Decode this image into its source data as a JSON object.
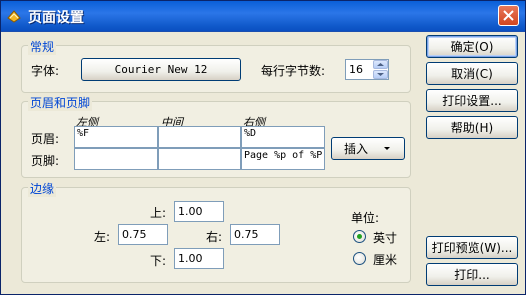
{
  "window": {
    "title": "页面设置"
  },
  "general": {
    "section_title": "常规",
    "font_label": "字体:",
    "font_value": "Courier New 12",
    "bytes_per_line_label": "每行字节数:",
    "bytes_per_line_value": "16"
  },
  "header_footer": {
    "section_title": "页眉和页脚",
    "col_left": "左侧",
    "col_center": "中间",
    "col_right": "右侧",
    "header_label": "页眉:",
    "footer_label": "页脚:",
    "header": {
      "left": "%F",
      "center": "",
      "right": "%D"
    },
    "footer": {
      "left": "",
      "center": "",
      "right": "Page %p of %P"
    },
    "insert_button": "插入"
  },
  "margins": {
    "section_title": "边缘",
    "top_label": "上:",
    "top_value": "1.00",
    "left_label": "左:",
    "left_value": "0.75",
    "right_label": "右:",
    "right_value": "0.75",
    "bottom_label": "下:",
    "bottom_value": "1.00",
    "units_label": "单位:",
    "unit_inch": "英寸",
    "unit_cm": "厘米",
    "selected_unit": "英寸"
  },
  "buttons": {
    "ok": "确定(O)",
    "cancel": "取消(C)",
    "print_setup": "打印设置...",
    "help": "帮助(H)",
    "print_preview": "打印预览(W)...",
    "print": "打印..."
  },
  "colors": {
    "title_bar": "#0a5fd8",
    "group_title": "#0046d5",
    "radio_selected": "#21a121"
  }
}
